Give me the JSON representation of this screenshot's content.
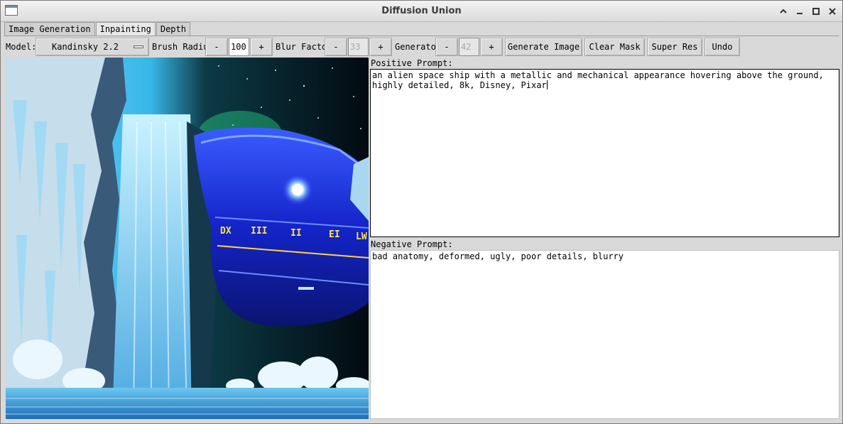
{
  "window": {
    "title": "Diffusion Union"
  },
  "tabs": [
    {
      "label": "Image Generation",
      "active": false
    },
    {
      "label": "Inpainting",
      "active": true
    },
    {
      "label": "Depth",
      "active": false
    }
  ],
  "toolbar": {
    "model_label": "Model:",
    "model_value": "Kandinsky 2.2",
    "brush_radius_label": "Brush Radius",
    "brush_radius_value": "100",
    "blur_factor_label": "Blur Factor",
    "blur_factor_value": "33",
    "generator_label": "Generator",
    "generator_value": "42",
    "minus": "-",
    "plus": "+",
    "generate_label": "Generate Image",
    "clear_mask_label": "Clear Mask",
    "super_res_label": "Super Res",
    "undo_label": "Undo"
  },
  "prompts": {
    "positive_label": "Positive Prompt:",
    "positive_text": "an alien space ship with a metallic and mechanical appearance hovering above the ground, highly detailed, 8k, Disney, Pixar",
    "negative_label": "Negative Prompt:",
    "negative_text": "bad anatomy, deformed, ugly, poor details, blurry"
  },
  "canvas": {
    "ship_window_labels": [
      "DX",
      "III",
      "II",
      "EI",
      "LW"
    ]
  },
  "icons": {
    "minimize": "minimize-icon",
    "maximize": "maximize-icon",
    "close": "close-icon",
    "collapse": "chevron-up-icon"
  }
}
